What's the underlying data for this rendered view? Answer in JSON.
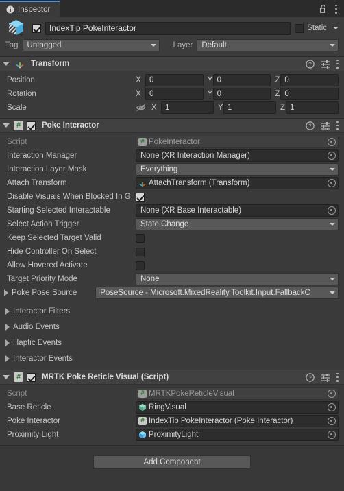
{
  "window": {
    "tab_label": "Inspector",
    "tab_icon": "info-icon",
    "lock_icon": "padlock-open-icon",
    "menu_icon": "kebab-menu-icon"
  },
  "gameobject": {
    "icon": "prefab-cube-icon",
    "enabled": true,
    "name": "IndexTip PokeInteractor",
    "static_label": "Static",
    "static_checked": false,
    "tag_label": "Tag",
    "tag_value": "Untagged",
    "layer_label": "Layer",
    "layer_value": "Default"
  },
  "components": [
    {
      "title": "Transform",
      "icon": "transform-axis-icon",
      "expanded": true,
      "has_enable_toggle": false,
      "help_icon": "help-icon",
      "preset_icon": "preset-sliders-icon",
      "menu_icon": "kebab-menu-icon",
      "vectors": [
        {
          "label": "Position",
          "x": "0",
          "y": "0",
          "z": "0",
          "lock_icon": null
        },
        {
          "label": "Rotation",
          "x": "0",
          "y": "0",
          "z": "0",
          "lock_icon": null
        },
        {
          "label": "Scale",
          "x": "1",
          "y": "1",
          "z": "1",
          "lock_icon": "eye-off-icon"
        }
      ],
      "axis_labels": {
        "x": "X",
        "y": "Y",
        "z": "Z"
      }
    },
    {
      "title": "Poke Interactor",
      "icon": "script-hash-icon",
      "expanded": true,
      "has_enable_toggle": true,
      "enabled": true,
      "help_icon": "help-icon",
      "preset_icon": "preset-sliders-icon",
      "menu_icon": "kebab-menu-icon",
      "properties": [
        {
          "type": "object",
          "label": "Script",
          "value": "PokeInteractor",
          "readonly": true,
          "icon": "script-hash-icon"
        },
        {
          "type": "object",
          "label": "Interaction Manager",
          "value": "None (XR Interaction Manager)",
          "readonly": false,
          "icon": null
        },
        {
          "type": "popup",
          "label": "Interaction Layer Mask",
          "value": "Everything"
        },
        {
          "type": "object",
          "label": "Attach Transform",
          "value": "AttachTransform (Transform)",
          "readonly": false,
          "icon": "transform-axis-icon"
        },
        {
          "type": "checkbox",
          "label": "Disable Visuals When Blocked In G",
          "checked": true,
          "clipped": true
        },
        {
          "type": "object",
          "label": "Starting Selected Interactable",
          "value": "None (XR Base Interactable)",
          "readonly": false,
          "icon": null
        },
        {
          "type": "popup",
          "label": "Select Action Trigger",
          "value": "State Change"
        },
        {
          "type": "checkbox",
          "label": "Keep Selected Target Valid",
          "checked": false
        },
        {
          "type": "checkbox",
          "label": "Hide Controller On Select",
          "checked": false
        },
        {
          "type": "checkbox",
          "label": "Allow Hovered Activate",
          "checked": false
        },
        {
          "type": "popup",
          "label": "Target Priority Mode",
          "value": "None"
        },
        {
          "type": "popup-foldout",
          "label": "Poke Pose Source",
          "value": "IPoseSource - Microsoft.MixedReality.Toolkit.Input.FallbackC"
        }
      ],
      "foldouts": [
        {
          "label": "Interactor Filters"
        },
        {
          "label": "Audio Events"
        },
        {
          "label": "Haptic Events"
        },
        {
          "label": "Interactor Events"
        }
      ]
    },
    {
      "title": "MRTK Poke Reticle Visual (Script)",
      "icon": "script-hash-icon",
      "expanded": true,
      "has_enable_toggle": true,
      "enabled": true,
      "help_icon": "help-icon",
      "preset_icon": "preset-sliders-icon",
      "menu_icon": "kebab-menu-icon",
      "properties": [
        {
          "type": "object",
          "label": "Script",
          "value": "MRTKPokeReticleVisual",
          "readonly": true,
          "icon": "script-hash-icon"
        },
        {
          "type": "object",
          "label": "Base Reticle",
          "value": "RingVisual",
          "readonly": false,
          "icon": "prefab-green-cube-icon"
        },
        {
          "type": "object",
          "label": "Poke Interactor",
          "value": "IndexTip PokeInteractor (Poke Interactor)",
          "readonly": false,
          "icon": "script-hash-icon"
        },
        {
          "type": "object",
          "label": "Proximity Light",
          "value": "ProximityLight",
          "readonly": false,
          "icon": "prefab-blue-cube-icon"
        }
      ]
    }
  ],
  "footer": {
    "add_component_label": "Add Component"
  },
  "colors": {
    "background": "#383838",
    "panel": "#3a3a3a",
    "header": "#414141",
    "field": "#2d2d2d",
    "popup": "#585858",
    "accent": "#4a8fd8",
    "text": "#c4c4c4"
  }
}
